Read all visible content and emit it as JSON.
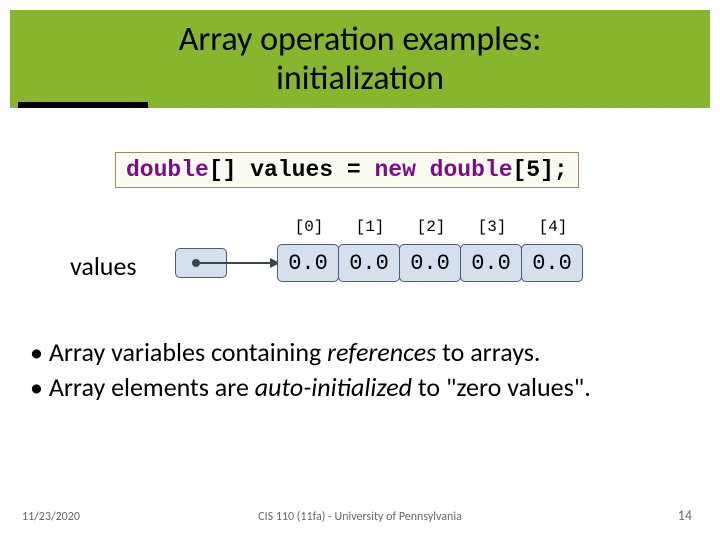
{
  "title": {
    "line1": "Array operation examples:",
    "line2": "initialization"
  },
  "code": {
    "kw1": "double",
    "t1": "[] values = ",
    "kw2": "new double",
    "t2": "[5];"
  },
  "diagram": {
    "var_label": "values",
    "indices": [
      "[0]",
      "[1]",
      "[2]",
      "[3]",
      "[4]"
    ],
    "cells": [
      "0.0",
      "0.0",
      "0.0",
      "0.0",
      "0.0"
    ]
  },
  "bullets": {
    "b1_pre": "• Array variables containing ",
    "b1_em": "references",
    "b1_post": " to arrays.",
    "b2_pre": "• Array elements are ",
    "b2_em": "auto-initialized",
    "b2_post": " to \"zero values\"."
  },
  "footer": {
    "date": "11/23/2020",
    "course": "CIS 110 (11fa) - University of Pennsylvania",
    "page": "14"
  }
}
